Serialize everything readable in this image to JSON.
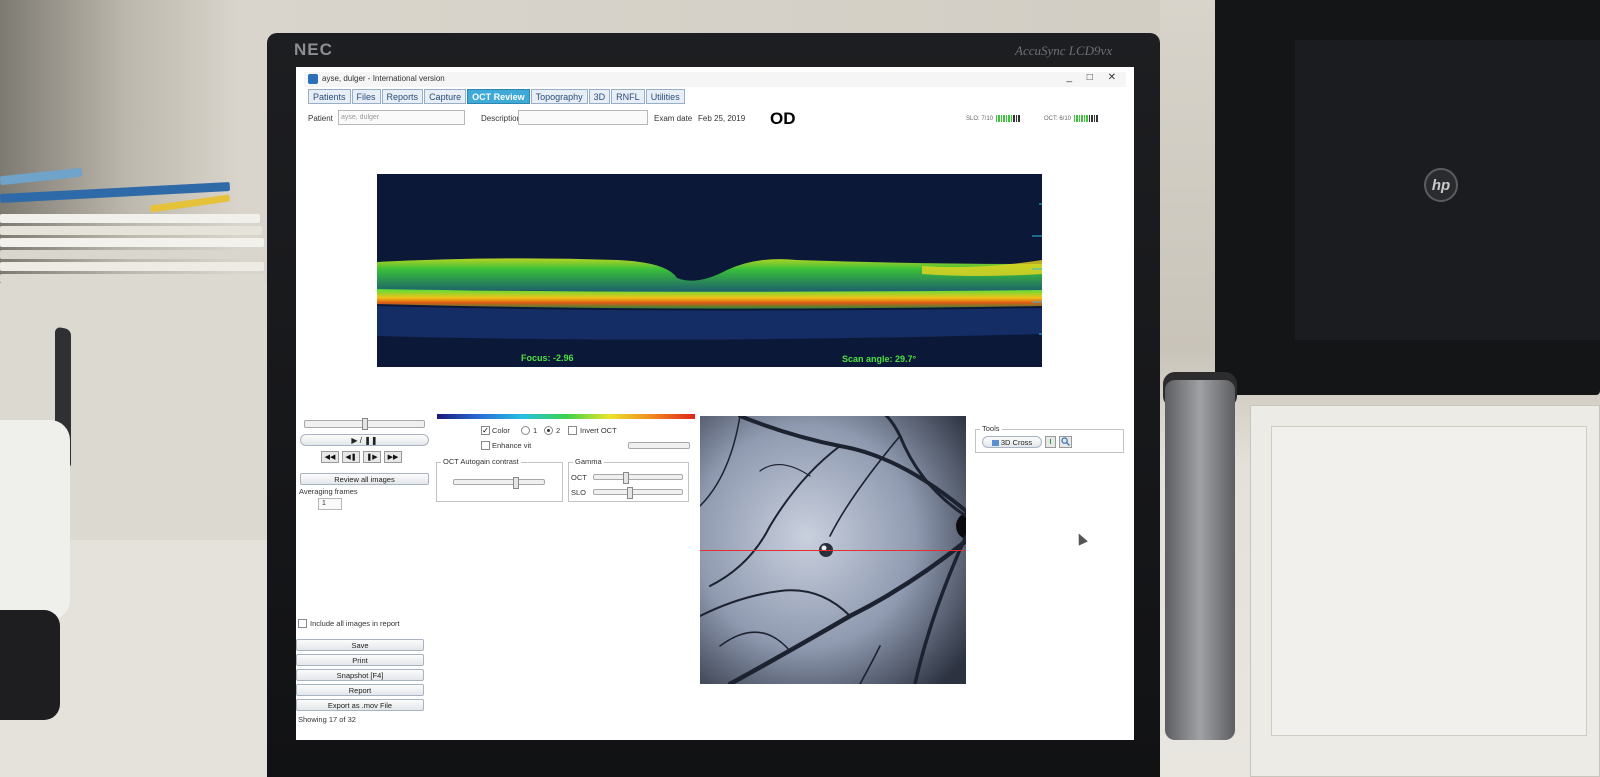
{
  "monitor": {
    "brand": "NEC",
    "model": "AccuSync LCD9vx"
  },
  "window": {
    "title": "ayse, dulger - International version",
    "controls": "_ □ ✕"
  },
  "tabs": [
    {
      "label": "Patients"
    },
    {
      "label": "Files"
    },
    {
      "label": "Reports"
    },
    {
      "label": "Capture"
    },
    {
      "label": "OCT Review",
      "active": true
    },
    {
      "label": "Topography"
    },
    {
      "label": "3D"
    },
    {
      "label": "RNFL"
    },
    {
      "label": "Utilities"
    }
  ],
  "header": {
    "patient_label": "Patient",
    "patient_value": "ayse, dulger",
    "description_label": "Description",
    "description_value": "",
    "exam_date_label": "Exam date",
    "exam_date_value": "Feb 25, 2019",
    "eye": "OD",
    "slo_quality": "SLO: 7/10",
    "slo_quality_fraction": 0.7,
    "oct_quality": "OCT: 6/10",
    "oct_quality_fraction": 0.6
  },
  "oct_image": {
    "focus": "Focus: -2.96",
    "scan_angle": "Scan angle: 29.7°"
  },
  "playback": {
    "position_fraction": 0.5,
    "play_pause": "▶ / ❚❚",
    "nav_buttons": [
      "◀◀",
      "◀❚",
      "❚▶",
      "▶▶"
    ],
    "review_all": "Review all images",
    "averaging_label": "Averaging frames",
    "averaging_value": "1"
  },
  "display_options": {
    "color_label": "Color",
    "color_checked": true,
    "radio_1": "1",
    "radio_2": "2",
    "radio_selected": "2",
    "invert_label": "Invert OCT",
    "invert_checked": false,
    "enhance_label": "Enhance vit",
    "enhance_checked": false
  },
  "autogain": {
    "title": "OCT Autogain contrast",
    "level_fraction": 0.7
  },
  "gamma": {
    "title": "Gamma",
    "oct_label": "OCT",
    "oct_fraction": 0.35,
    "slo_label": "SLO",
    "slo_fraction": 0.4
  },
  "tools": {
    "title": "Tools",
    "cross_label": "3D Cross",
    "info_icon": "info-icon",
    "zoom_icon": "magnifier-icon"
  },
  "report_actions": {
    "include_label": "Include all images in report",
    "include_checked": false,
    "buttons": [
      "Save",
      "Print",
      "Snapshot [F4]",
      "Report",
      "Export as .mov File"
    ]
  },
  "status": "Showing 17 of 32",
  "colors": {
    "active_tab": "#3fa9d8",
    "oct_background": "#0d1a3d",
    "quality_good": "#3cc43c",
    "quality_empty": "#333333",
    "scan_line": "#e03030"
  }
}
